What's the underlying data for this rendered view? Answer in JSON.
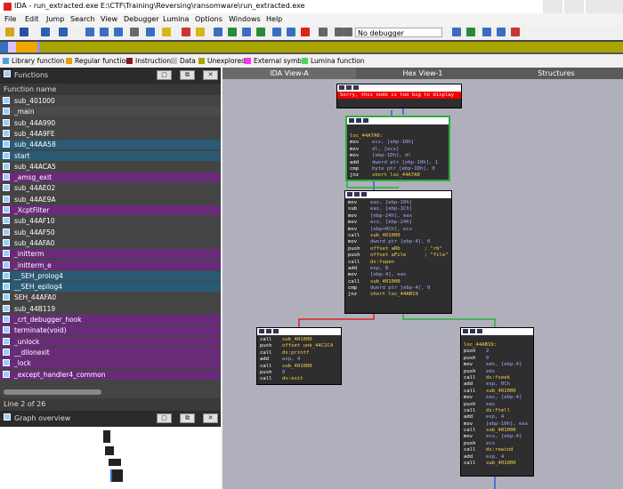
{
  "window": {
    "title": "IDA - run_extracted.exe E:\\CTF\\Training\\Reversing\\ransomware\\run_extracted.exe"
  },
  "menu": [
    "File",
    "Edit",
    "Jump",
    "Search",
    "View",
    "Debugger",
    "Lumina",
    "Options",
    "Windows",
    "Help"
  ],
  "toolbar": {
    "debugger_select": "No debugger"
  },
  "legend": [
    {
      "label": "Library function",
      "color": "#4aa3df"
    },
    {
      "label": "Regular function",
      "color": "#e0a010"
    },
    {
      "label": "Instruction",
      "color": "#8b1a1a"
    },
    {
      "label": "Data",
      "color": "#c0c0c0"
    },
    {
      "label": "Unexplored",
      "color": "#a9a400"
    },
    {
      "label": "External symbol",
      "color": "#ff30ff"
    },
    {
      "label": "Lumina function",
      "color": "#4fd65a"
    }
  ],
  "functions": {
    "title": "Functions",
    "column": "Function name",
    "status": "Line 2 of 26",
    "items": [
      {
        "name": "sub_401000",
        "bg": "#444444"
      },
      {
        "name": "_main",
        "bg": "#4a4a4a"
      },
      {
        "name": "sub_44A990",
        "bg": "#444444"
      },
      {
        "name": "sub_44A9FE",
        "bg": "#444444"
      },
      {
        "name": "sub_44AA58",
        "bg": "#2a5a74"
      },
      {
        "name": "start",
        "bg": "#2a5a74"
      },
      {
        "name": "sub_44ACA5",
        "bg": "#444444"
      },
      {
        "name": "_amsg_exit",
        "bg": "#6a2a7a"
      },
      {
        "name": "sub_44AE02",
        "bg": "#444444"
      },
      {
        "name": "sub_44AE9A",
        "bg": "#444444"
      },
      {
        "name": "_XcptFilter",
        "bg": "#6a2a7a"
      },
      {
        "name": "sub_44AF10",
        "bg": "#444444"
      },
      {
        "name": "sub_44AF50",
        "bg": "#444444"
      },
      {
        "name": "sub_44AFA0",
        "bg": "#444444"
      },
      {
        "name": "_initterm",
        "bg": "#6a2a7a"
      },
      {
        "name": "_initterm_e",
        "bg": "#6a2a7a"
      },
      {
        "name": "__SEH_prolog4",
        "bg": "#2a5a74"
      },
      {
        "name": "__SEH_epilog4",
        "bg": "#2a5a74"
      },
      {
        "name": "SEH_44AFA0",
        "bg": "#444444"
      },
      {
        "name": "sub_44B119",
        "bg": "#444444"
      },
      {
        "name": "_crt_debugger_hook",
        "bg": "#6a2a7a"
      },
      {
        "name": "terminate(void)",
        "bg": "#6a2a7a"
      },
      {
        "name": "_unlock",
        "bg": "#6a2a7a"
      },
      {
        "name": "__dllonexit",
        "bg": "#6a2a7a"
      },
      {
        "name": "_lock",
        "bg": "#6a2a7a"
      },
      {
        "name": "_except_handler4_common",
        "bg": "#6a2a7a"
      }
    ]
  },
  "overview": {
    "title": "Graph overview"
  },
  "tabs": [
    "IDA View-A",
    "Hex View-1",
    "Structures"
  ],
  "graph": {
    "top_block": "Sorry, this node is too big to display",
    "loop_block": [
      {
        "t": "lab",
        "x": "loc_44A7A0:"
      },
      {
        "m": "mov",
        "a": "ecx, [ebp-10h]"
      },
      {
        "m": "mov",
        "a": "dl, [ecx]"
      },
      {
        "m": "mov",
        "a": "[ebp-1Dh], dl"
      },
      {
        "m": "add",
        "a": "dword ptr [ebp-10h], 1"
      },
      {
        "m": "cmp",
        "a": "byte ptr [ebp-1Dh], 0"
      },
      {
        "m": "jnz",
        "a": "short loc_44A7A0"
      }
    ],
    "main_block": [
      {
        "m": "mov",
        "a": "eax, [ebp-10h]"
      },
      {
        "m": "sub",
        "a": "eax, [ebp-1Ch]"
      },
      {
        "m": "mov",
        "a": "[ebp-24h], eax"
      },
      {
        "m": "mov",
        "a": "ecx, [ebp-24h]"
      },
      {
        "m": "mov",
        "a": "[ebp+0Ch], ecx"
      },
      {
        "m": "call",
        "a": "sub_401000"
      },
      {
        "m": "mov",
        "a": "dword ptr [ebp-4], 0"
      },
      {
        "m": "push",
        "a": "offset aRb        ; \"rb\""
      },
      {
        "m": "push",
        "a": "offset aFile      ; \"file\""
      },
      {
        "m": "call",
        "a": "ds:fopen"
      },
      {
        "m": "add",
        "a": "esp, 8"
      },
      {
        "m": "mov",
        "a": "[ebp-4], eax"
      },
      {
        "m": "call",
        "a": "sub_401000"
      },
      {
        "m": "cmp",
        "a": "dword ptr [ebp-4], 0"
      },
      {
        "m": "jnz",
        "a": "short loc_44AB19"
      }
    ],
    "left_block": [
      {
        "m": "call",
        "a": "sub_401000"
      },
      {
        "m": "push",
        "a": "offset unk_44C1C4"
      },
      {
        "m": "call",
        "a": "ds:printf"
      },
      {
        "m": "add",
        "a": "esp, 4"
      },
      {
        "m": "call",
        "a": "sub_401000"
      },
      {
        "m": "push",
        "a": "0"
      },
      {
        "m": "call",
        "a": "ds:exit"
      }
    ],
    "right_block": [
      {
        "t": "lab",
        "x": "loc_44AB19:"
      },
      {
        "m": "push",
        "a": "2"
      },
      {
        "m": "push",
        "a": "0"
      },
      {
        "m": "mov",
        "a": "edx, [ebp-4]"
      },
      {
        "m": "push",
        "a": "edx"
      },
      {
        "m": "call",
        "a": "ds:fseek"
      },
      {
        "m": "add",
        "a": "esp, 0Ch"
      },
      {
        "m": "call",
        "a": "sub_401000"
      },
      {
        "m": "mov",
        "a": "eax, [ebp-4]"
      },
      {
        "m": "push",
        "a": "eax"
      },
      {
        "m": "call",
        "a": "ds:ftell"
      },
      {
        "m": "add",
        "a": "esp, 4"
      },
      {
        "m": "mov",
        "a": "[ebp-10h], eax"
      },
      {
        "m": "call",
        "a": "sub_401000"
      },
      {
        "m": "mov",
        "a": "ecx, [ebp-4]"
      },
      {
        "m": "push",
        "a": "ecx"
      },
      {
        "m": "call",
        "a": "ds:rewind"
      },
      {
        "m": "add",
        "a": "esp, 4"
      },
      {
        "m": "call",
        "a": "sub_401000"
      }
    ]
  }
}
